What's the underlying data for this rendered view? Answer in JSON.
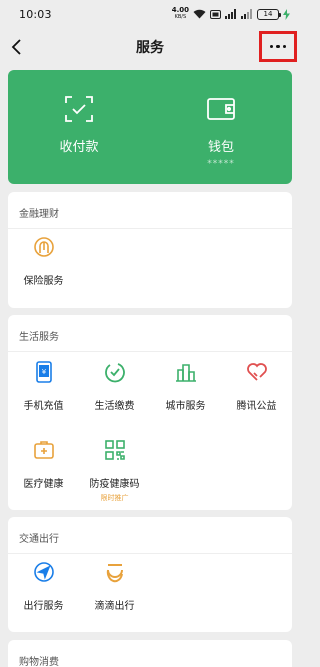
{
  "status_bar": {
    "time": "10:03",
    "net_speed": "4.00",
    "net_unit": "KB/S",
    "battery": "14"
  },
  "nav": {
    "title": "服务"
  },
  "wallet_card": {
    "items": [
      {
        "label": "收付款",
        "icon": "scan-pay-icon"
      },
      {
        "label": "钱包",
        "sub": "*****",
        "icon": "wallet-icon"
      }
    ],
    "color": "#3cb06b"
  },
  "sections": [
    {
      "title": "金融理财",
      "items": [
        {
          "label": "保险服务",
          "icon": "insurance-icon",
          "color": "#e8a23c"
        }
      ]
    },
    {
      "title": "生活服务",
      "items": [
        {
          "label": "手机充值",
          "icon": "phone-recharge-icon",
          "color": "#1a7ee8"
        },
        {
          "label": "生活缴费",
          "icon": "utility-bill-icon",
          "color": "#3cb06b"
        },
        {
          "label": "城市服务",
          "icon": "city-service-icon",
          "color": "#3cb06b"
        },
        {
          "label": "腾讯公益",
          "icon": "charity-heart-icon",
          "color": "#e05050"
        },
        {
          "label": "医疗健康",
          "icon": "medical-icon",
          "color": "#e8a23c"
        },
        {
          "label": "防疫健康码",
          "tag": "限时推广",
          "icon": "health-code-icon",
          "color": "#3cb06b"
        }
      ]
    },
    {
      "title": "交通出行",
      "items": [
        {
          "label": "出行服务",
          "icon": "travel-icon",
          "color": "#1a7ee8"
        },
        {
          "label": "滴滴出行",
          "icon": "didi-icon",
          "color": "#e8a23c"
        }
      ]
    },
    {
      "title": "购物消费",
      "items": []
    }
  ]
}
